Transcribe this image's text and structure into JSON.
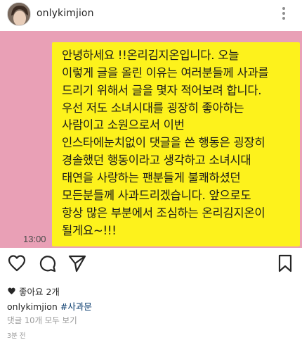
{
  "header": {
    "username": "onlykimjion"
  },
  "photo": {
    "message_lines": [
      "안녕하세요 !!온리김지온입니다. 오늘",
      "이렇게 글을 올린 이유는 여러분들께 사과를",
      "드리기 위해서 글을 몇자 적어보려 합니다.",
      "우선 저도 소녀시대를 굉장히 좋아하는",
      "사람이고 소원으로서 이번",
      "인스타에눈치없이 댓글을 쓴 행동은 굉장히",
      "경솔했던 행동이라고 생각하고 소녀시대",
      "태연을 사랑하는 팬분들게 불쾌하셨던",
      "모든분들께 사과드리겠습니다. 앞으로도",
      "항상 많은 부분에서 조심하는 온리김지온이",
      "될게요~!!!"
    ],
    "timestamp": "13:00",
    "colors": {
      "background": "#e9a0b6",
      "bubble": "#fdf21c"
    }
  },
  "actions": {
    "icons": [
      "heart-icon",
      "comment-icon",
      "share-icon",
      "bookmark-icon"
    ]
  },
  "post": {
    "likes_text": "좋아요 2개",
    "caption_user": "onlykimjion",
    "caption_tag": "#사과문",
    "comments_link": "댓글 10개 모두 보기",
    "time_ago": "3분 전"
  }
}
